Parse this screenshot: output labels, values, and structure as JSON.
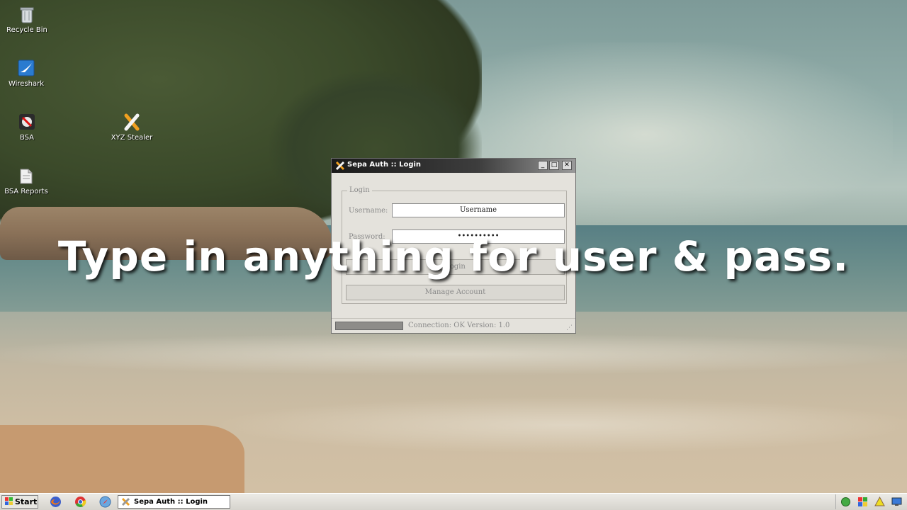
{
  "desktop": {
    "icons": [
      {
        "label": "Recycle Bin",
        "icon": "recycle-bin-icon"
      },
      {
        "label": "Wireshark",
        "icon": "wireshark-icon"
      },
      {
        "label": "BSA",
        "icon": "bsa-icon"
      },
      {
        "label": "BSA Reports",
        "icon": "bsa-reports-icon"
      },
      {
        "label": "XYZ Stealer",
        "icon": "xyz-stealer-icon"
      }
    ]
  },
  "window": {
    "title": "Sepa Auth :: Login",
    "title_buttons": {
      "minimize": "_",
      "maximize": "□",
      "close": "✕"
    },
    "group_label": "Login",
    "username_label": "Username:",
    "username_value": "Username",
    "password_label": "Password:",
    "password_value": "••••••••••",
    "login_button": "Login",
    "manage_button": "Manage Account",
    "status_text": "Connection: OK   Version: 1.0"
  },
  "caption": "Type in anything for user & pass.",
  "taskbar": {
    "start_label": "Start",
    "task_label": "Sepa Auth :: Login"
  },
  "colors": {
    "titlebar_dark": "#1a1a1a",
    "window_bg": "#e4e2dc",
    "accent_orange": "#f0a020"
  }
}
